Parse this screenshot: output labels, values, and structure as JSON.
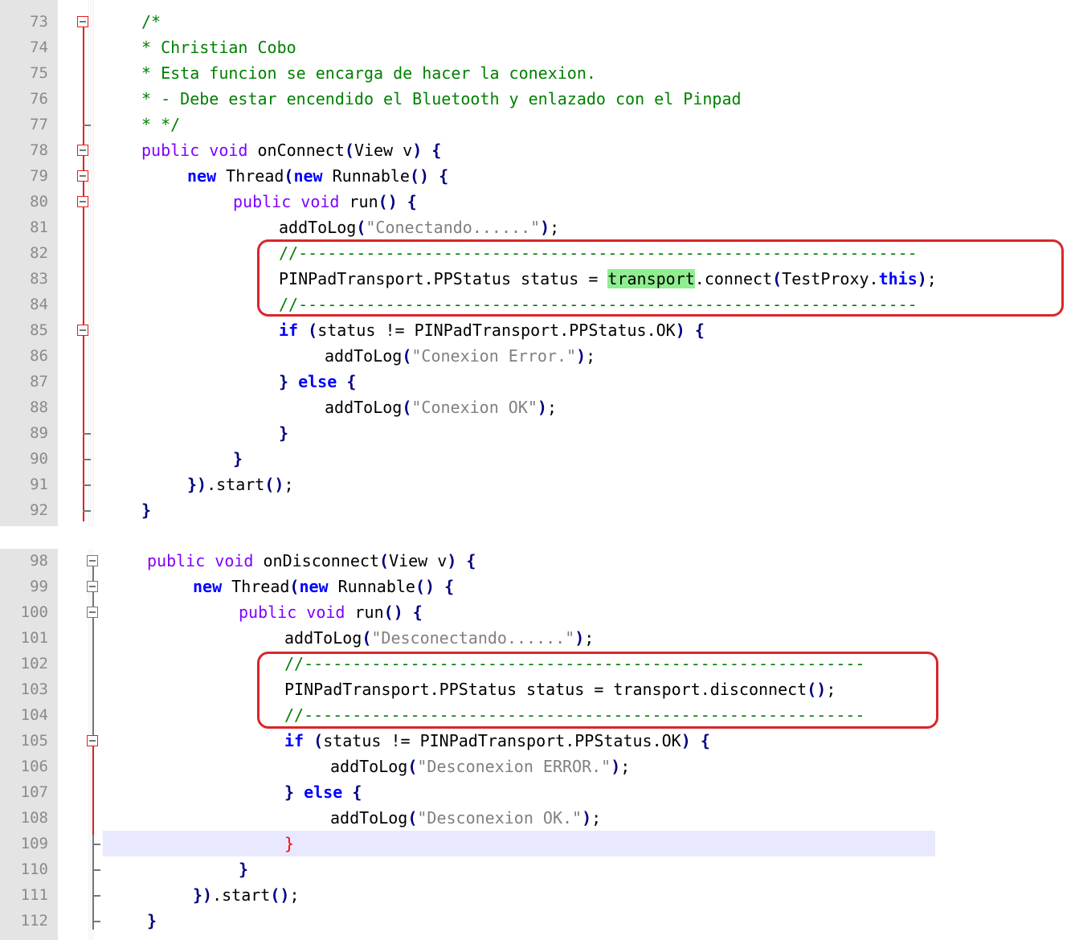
{
  "panels": [
    {
      "name": "on-connect-panel",
      "lines": [
        {
          "n": "73",
          "code": "/*"
        },
        {
          "n": "74",
          "code": "* Christian Cobo"
        },
        {
          "n": "75",
          "code": "* Esta funcion se encarga de hacer la conexion."
        },
        {
          "n": "76",
          "code": "* - Debe estar encendido el Bluetooth y enlazado con el Pinpad"
        },
        {
          "n": "77",
          "code": "* */"
        },
        {
          "n": "78",
          "code": "public void onConnect(View v) {"
        },
        {
          "n": "79",
          "code": "new Thread(new Runnable() {"
        },
        {
          "n": "80",
          "code": "public void run() {"
        },
        {
          "n": "81",
          "code": "addToLog(\"Conectando......\");"
        },
        {
          "n": "82",
          "code": "//----------------------------------------------------------------"
        },
        {
          "n": "83",
          "code": "PINPadTransport.PPStatus status = transport.connect(TestProxy.this);"
        },
        {
          "n": "84",
          "code": "//----------------------------------------------------------------"
        },
        {
          "n": "85",
          "code": "if (status != PINPadTransport.PPStatus.OK) {"
        },
        {
          "n": "86",
          "code": "addToLog(\"Conexion Error.\");"
        },
        {
          "n": "87",
          "code": "} else {"
        },
        {
          "n": "88",
          "code": "addToLog(\"Conexion OK\");"
        },
        {
          "n": "89",
          "code": "}"
        },
        {
          "n": "90",
          "code": "}"
        },
        {
          "n": "91",
          "code": "}).start();"
        },
        {
          "n": "92",
          "code": "}"
        }
      ]
    },
    {
      "name": "on-disconnect-panel",
      "lines": [
        {
          "n": "98",
          "code": "public void onDisconnect(View v) {"
        },
        {
          "n": "99",
          "code": "new Thread(new Runnable() {"
        },
        {
          "n": "100",
          "code": "public void run() {"
        },
        {
          "n": "101",
          "code": "addToLog(\"Desconectando......\");"
        },
        {
          "n": "102",
          "code": "//----------------------------------------------------------"
        },
        {
          "n": "103",
          "code": "PINPadTransport.PPStatus status = transport.disconnect();"
        },
        {
          "n": "104",
          "code": "//----------------------------------------------------------"
        },
        {
          "n": "105",
          "code": "if (status != PINPadTransport.PPStatus.OK) {"
        },
        {
          "n": "106",
          "code": "addToLog(\"Desconexion ERROR.\");"
        },
        {
          "n": "107",
          "code": "} else {"
        },
        {
          "n": "108",
          "code": "addToLog(\"Desconexion OK.\");"
        },
        {
          "n": "109",
          "code": "}"
        },
        {
          "n": "110",
          "code": "}"
        },
        {
          "n": "111",
          "code": "}).start();"
        },
        {
          "n": "112",
          "code": "}"
        }
      ]
    }
  ],
  "colors": {
    "keyword": "#0000ff",
    "type": "#8000ff",
    "string": "#808080",
    "comment": "#008000",
    "highlight": "#8fee8f",
    "annotation_box": "#d9262a"
  }
}
